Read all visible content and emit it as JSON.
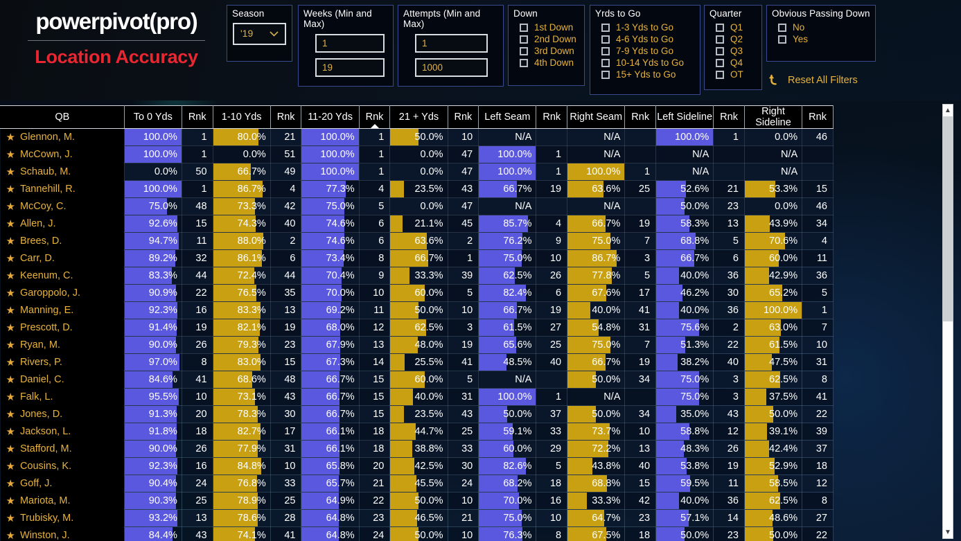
{
  "brand": {
    "word": "powerpivot(pro)",
    "subtitle": "Location Accuracy"
  },
  "slicers": {
    "season": {
      "title": "Season",
      "value": "'19",
      "caret_icon": "chevron-down-icon"
    },
    "weeks": {
      "title": "Weeks (Min and Max)",
      "min": "1",
      "max": "19"
    },
    "attempts": {
      "title": "Attempts (Min and Max)",
      "min": "1",
      "max": "1000"
    },
    "down": {
      "title": "Down",
      "options": [
        "1st Down",
        "2nd Down",
        "3rd Down",
        "4th Down"
      ]
    },
    "yds_to_go": {
      "title": "Yrds to Go",
      "options": [
        "1-3 Yds to Go",
        "4-6 Yds to Go",
        "7-9 Yds to Go",
        "10-14 Yds to Go",
        "15+ Yds to Go"
      ]
    },
    "quarter": {
      "title": "Quarter",
      "options": [
        "Q1",
        "Q2",
        "Q3",
        "Q4",
        "OT"
      ]
    },
    "opd": {
      "title": "Obvious Passing Down",
      "options": [
        "No",
        "Yes"
      ]
    },
    "reset": {
      "label": "Reset All Filters",
      "icon": "undo-arrow-icon"
    }
  },
  "colors": {
    "accent_gold": "#e8b33c",
    "brand_red": "#ea2630",
    "bar_blue": "#5b58e0",
    "bar_gold": "#c8a011"
  },
  "table": {
    "sorted_column_index": 6,
    "sort_direction": "asc",
    "columns": [
      {
        "label": "QB",
        "type": "name"
      },
      {
        "label": "To 0 Yds",
        "type": "pct",
        "bar": "blue"
      },
      {
        "label": "Rnk",
        "type": "rank"
      },
      {
        "label": "1-10 Yds",
        "type": "pct",
        "bar": "gold"
      },
      {
        "label": "Rnk",
        "type": "rank"
      },
      {
        "label": "11-20 Yds",
        "type": "pct",
        "bar": "blue"
      },
      {
        "label": "Rnk",
        "type": "rank"
      },
      {
        "label": "21 + Yds",
        "type": "pct",
        "bar": "gold"
      },
      {
        "label": "Rnk",
        "type": "rank"
      },
      {
        "label": "Left Seam",
        "type": "pct",
        "bar": "blue"
      },
      {
        "label": "Rnk",
        "type": "rank"
      },
      {
        "label": "Right Seam",
        "type": "pct",
        "bar": "gold"
      },
      {
        "label": "Rnk",
        "type": "rank"
      },
      {
        "label": "Left Sideline",
        "type": "pct",
        "bar": "blue"
      },
      {
        "label": "Rnk",
        "type": "rank"
      },
      {
        "label": "Right Sideline",
        "type": "pct",
        "bar": "gold"
      },
      {
        "label": "Rnk",
        "type": "rank"
      }
    ],
    "rows": [
      {
        "qb": "Glennon, M.",
        "cells": [
          "100.0%",
          "1",
          "80.0%",
          "21",
          "100.0%",
          "1",
          "50.0%",
          "10",
          "N/A",
          "",
          "N/A",
          "",
          "100.0%",
          "1",
          "0.0%",
          "46"
        ]
      },
      {
        "qb": "McCown, J.",
        "cells": [
          "100.0%",
          "1",
          "0.0%",
          "51",
          "100.0%",
          "1",
          "0.0%",
          "47",
          "100.0%",
          "1",
          "N/A",
          "",
          "N/A",
          "",
          "N/A",
          ""
        ]
      },
      {
        "qb": "Schaub, M.",
        "cells": [
          "0.0%",
          "50",
          "66.7%",
          "49",
          "100.0%",
          "1",
          "0.0%",
          "47",
          "100.0%",
          "1",
          "100.0%",
          "1",
          "N/A",
          "",
          "N/A",
          ""
        ]
      },
      {
        "qb": "Tannehill, R.",
        "cells": [
          "100.0%",
          "1",
          "86.7%",
          "4",
          "77.3%",
          "4",
          "23.5%",
          "43",
          "66.7%",
          "19",
          "63.6%",
          "25",
          "52.6%",
          "21",
          "53.3%",
          "15"
        ]
      },
      {
        "qb": "McCoy, C.",
        "cells": [
          "75.0%",
          "48",
          "73.3%",
          "42",
          "75.0%",
          "5",
          "0.0%",
          "47",
          "N/A",
          "",
          "N/A",
          "",
          "50.0%",
          "23",
          "0.0%",
          "46"
        ]
      },
      {
        "qb": "Allen, J.",
        "cells": [
          "92.6%",
          "15",
          "74.3%",
          "40",
          "74.6%",
          "6",
          "21.1%",
          "45",
          "85.7%",
          "4",
          "66.7%",
          "19",
          "58.3%",
          "13",
          "43.9%",
          "34"
        ]
      },
      {
        "qb": "Brees, D.",
        "cells": [
          "94.7%",
          "11",
          "88.0%",
          "2",
          "74.6%",
          "6",
          "63.6%",
          "2",
          "76.2%",
          "9",
          "75.0%",
          "7",
          "68.8%",
          "5",
          "70.6%",
          "4"
        ]
      },
      {
        "qb": "Carr, D.",
        "cells": [
          "89.2%",
          "32",
          "86.1%",
          "6",
          "73.4%",
          "8",
          "66.7%",
          "1",
          "75.0%",
          "10",
          "86.7%",
          "3",
          "66.7%",
          "6",
          "60.0%",
          "11"
        ]
      },
      {
        "qb": "Keenum, C.",
        "cells": [
          "83.3%",
          "44",
          "72.4%",
          "44",
          "70.4%",
          "9",
          "33.3%",
          "39",
          "62.5%",
          "26",
          "77.8%",
          "5",
          "40.0%",
          "36",
          "42.9%",
          "36"
        ]
      },
      {
        "qb": "Garoppolo, J.",
        "cells": [
          "90.9%",
          "22",
          "76.5%",
          "35",
          "70.0%",
          "10",
          "60.0%",
          "5",
          "82.4%",
          "6",
          "67.6%",
          "17",
          "46.2%",
          "30",
          "65.2%",
          "5"
        ]
      },
      {
        "qb": "Manning, E.",
        "cells": [
          "92.3%",
          "16",
          "83.3%",
          "13",
          "69.2%",
          "11",
          "50.0%",
          "10",
          "66.7%",
          "19",
          "40.0%",
          "41",
          "40.0%",
          "36",
          "100.0%",
          "1"
        ]
      },
      {
        "qb": "Prescott, D.",
        "cells": [
          "91.4%",
          "19",
          "82.1%",
          "19",
          "68.0%",
          "12",
          "62.5%",
          "3",
          "61.5%",
          "27",
          "54.8%",
          "31",
          "75.6%",
          "2",
          "63.0%",
          "7"
        ]
      },
      {
        "qb": "Ryan, M.",
        "cells": [
          "90.0%",
          "26",
          "79.3%",
          "23",
          "67.9%",
          "13",
          "48.0%",
          "19",
          "65.6%",
          "25",
          "75.0%",
          "7",
          "51.3%",
          "22",
          "61.5%",
          "10"
        ]
      },
      {
        "qb": "Rivers, P.",
        "cells": [
          "97.0%",
          "8",
          "83.0%",
          "15",
          "67.3%",
          "14",
          "25.5%",
          "41",
          "48.5%",
          "40",
          "66.7%",
          "19",
          "38.2%",
          "40",
          "47.5%",
          "31"
        ]
      },
      {
        "qb": "Daniel, C.",
        "cells": [
          "84.6%",
          "41",
          "68.6%",
          "48",
          "66.7%",
          "15",
          "60.0%",
          "5",
          "N/A",
          "",
          "50.0%",
          "34",
          "75.0%",
          "3",
          "62.5%",
          "8"
        ]
      },
      {
        "qb": "Falk, L.",
        "cells": [
          "95.5%",
          "10",
          "73.1%",
          "43",
          "66.7%",
          "15",
          "40.0%",
          "31",
          "100.0%",
          "1",
          "N/A",
          "",
          "75.0%",
          "3",
          "37.5%",
          "41"
        ]
      },
      {
        "qb": "Jones, D.",
        "cells": [
          "91.3%",
          "20",
          "78.3%",
          "30",
          "66.7%",
          "15",
          "23.5%",
          "43",
          "50.0%",
          "37",
          "50.0%",
          "34",
          "35.0%",
          "43",
          "50.0%",
          "22"
        ]
      },
      {
        "qb": "Jackson, L.",
        "cells": [
          "91.8%",
          "18",
          "82.7%",
          "17",
          "66.1%",
          "18",
          "44.7%",
          "25",
          "59.1%",
          "33",
          "73.7%",
          "10",
          "58.8%",
          "12",
          "39.1%",
          "39"
        ]
      },
      {
        "qb": "Stafford, M.",
        "cells": [
          "90.0%",
          "26",
          "77.9%",
          "31",
          "66.1%",
          "18",
          "38.8%",
          "33",
          "60.0%",
          "29",
          "72.2%",
          "13",
          "48.3%",
          "26",
          "42.4%",
          "37"
        ]
      },
      {
        "qb": "Cousins, K.",
        "cells": [
          "92.3%",
          "16",
          "84.8%",
          "10",
          "65.8%",
          "20",
          "42.5%",
          "30",
          "82.6%",
          "5",
          "43.8%",
          "40",
          "53.8%",
          "19",
          "52.9%",
          "18"
        ]
      },
      {
        "qb": "Goff, J.",
        "cells": [
          "90.4%",
          "24",
          "76.8%",
          "33",
          "65.7%",
          "21",
          "45.5%",
          "24",
          "68.2%",
          "18",
          "68.8%",
          "15",
          "59.5%",
          "11",
          "58.5%",
          "12"
        ]
      },
      {
        "qb": "Mariota, M.",
        "cells": [
          "90.3%",
          "25",
          "78.9%",
          "25",
          "64.9%",
          "22",
          "50.0%",
          "10",
          "70.0%",
          "16",
          "33.3%",
          "42",
          "40.0%",
          "36",
          "62.5%",
          "8"
        ]
      },
      {
        "qb": "Trubisky, M.",
        "cells": [
          "93.2%",
          "13",
          "78.6%",
          "28",
          "64.8%",
          "23",
          "46.5%",
          "21",
          "75.0%",
          "10",
          "64.7%",
          "23",
          "57.1%",
          "14",
          "48.6%",
          "27"
        ]
      },
      {
        "qb": "Winston, J.",
        "cells": [
          "84.4%",
          "43",
          "74.1%",
          "41",
          "64.8%",
          "24",
          "50.0%",
          "10",
          "76.3%",
          "8",
          "67.5%",
          "18",
          "50.0%",
          "23",
          "50.0%",
          "22"
        ]
      }
    ]
  },
  "scrollbar": {
    "up_icon": "chevron-up-icon",
    "down_icon": "chevron-down-icon"
  }
}
